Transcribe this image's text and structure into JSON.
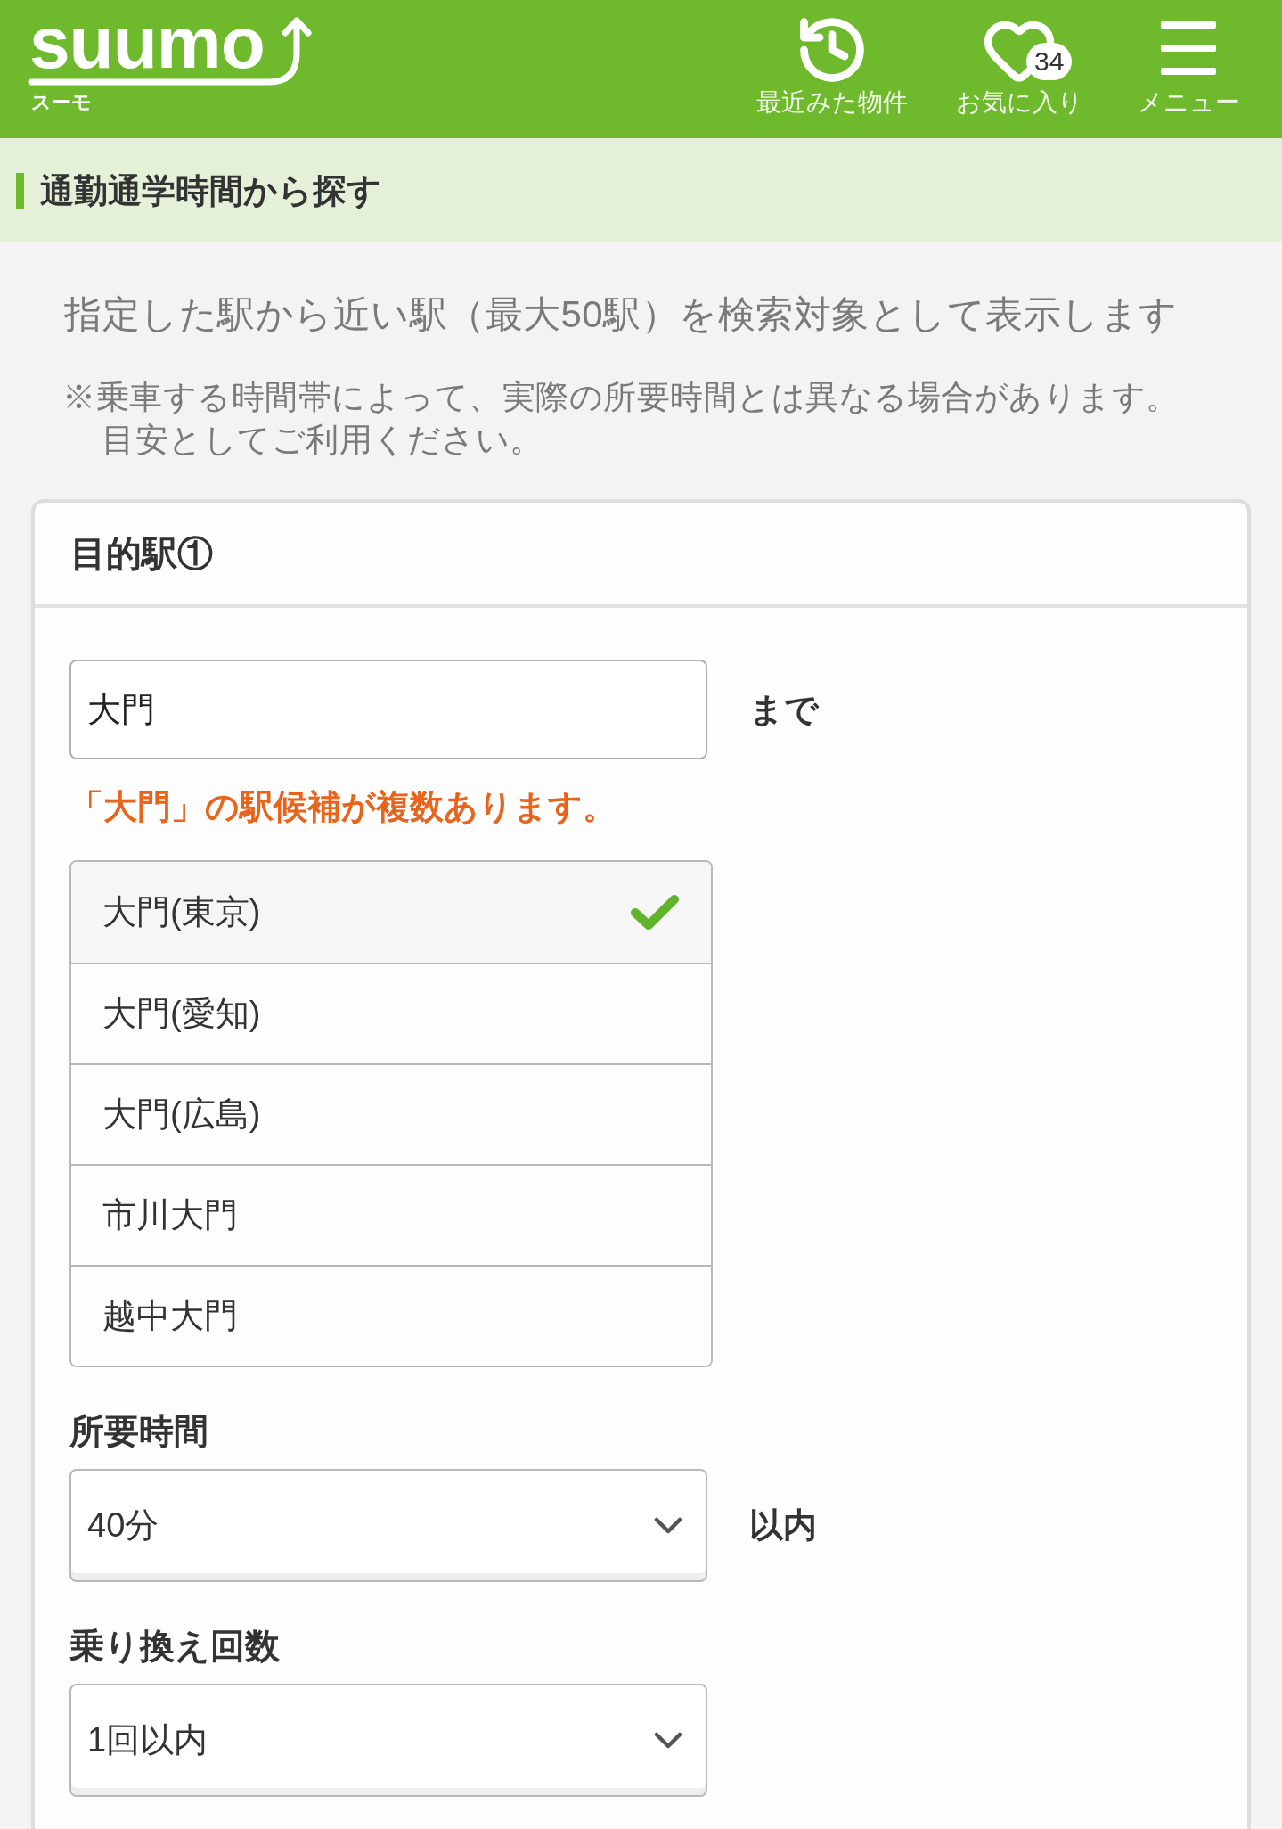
{
  "header": {
    "logo": {
      "wordmark": "suumo",
      "subtitle": "スーモ"
    },
    "nav": [
      {
        "kind": "history",
        "label": "最近みた物件"
      },
      {
        "kind": "favorites",
        "label": "お気に入り",
        "badge": "34"
      },
      {
        "kind": "menu",
        "label": "メニュー"
      }
    ]
  },
  "page_title": "通勤通学時間から探す",
  "description": "指定した駅から近い駅（最大50駅）を検索対象として表示します",
  "note_lines": [
    "※乗車する時間帯によって、実際の所要時間とは異なる場合があります。",
    "目安としてご利用ください。"
  ],
  "destination": {
    "title": "目的駅①",
    "station": {
      "value": "大門",
      "suffix": "まで"
    },
    "warning": "「大門」の駅候補が複数あります。",
    "candidates": [
      {
        "name": "大門(東京)",
        "selected": true
      },
      {
        "name": "大門(愛知)",
        "selected": false
      },
      {
        "name": "大門(広島)",
        "selected": false
      },
      {
        "name": "市川大門",
        "selected": false
      },
      {
        "name": "越中大門",
        "selected": false
      }
    ],
    "fields": [
      {
        "label": "所要時間",
        "value": "40分",
        "suffix": "以内"
      },
      {
        "label": "乗り換え回数",
        "value": "1回以内"
      }
    ]
  }
}
